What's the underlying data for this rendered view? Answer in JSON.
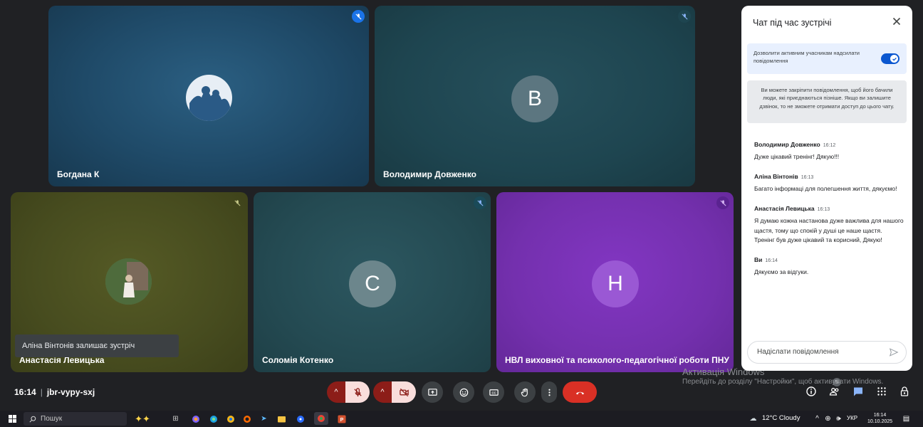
{
  "tiles": [
    {
      "name": "Богдана К",
      "initial": ""
    },
    {
      "name": "Володимир Довженко",
      "initial": "В"
    },
    {
      "name": "Анастасія Левицька",
      "initial": ""
    },
    {
      "name": "Соломія Котенко",
      "initial": "С"
    },
    {
      "name": "НВЛ виховної та психолого-педагогічної роботи ПНУ",
      "initial": "Н"
    }
  ],
  "toast": "Аліна Вінтонів залишає зустріч",
  "meeting": {
    "time": "16:14",
    "separator": "|",
    "code": "jbr-vypy-sxj"
  },
  "watermark": {
    "title": "Активація Windows",
    "subtitle": "Перейдіть до розділу \"Настройки\", щоб активувати Windows."
  },
  "controls": {
    "badge_count": "5"
  },
  "chat": {
    "title": "Чат під час зустрічі",
    "toggle_label": "Дозволити активним учасникам надсилати повідомлення",
    "toggle_on": true,
    "info": "Ви можете закріпити повідомлення, щоб його бачили люди, які приєднаються пізніше. Якщо ви залишите дзвінок, то не зможете отримати доступ до цього чату.",
    "messages": [
      {
        "author": "Володимир Довженко",
        "time": "16:12",
        "text": "Дуже цікавий тренінг! Дякую!!!"
      },
      {
        "author": "Аліна Вінтонів",
        "time": "16:13",
        "text": "Багато інформаці для полегшення життя, дякуємо!"
      },
      {
        "author": "Анастасія Левицька",
        "time": "16:13",
        "text": "Я думаю кожна настанова дуже важлива для нашого щастя, тому що спокій у душі це наше щастя. Тренінг був дуже цікавий та корисний, Дякую!"
      },
      {
        "author": "Ви",
        "time": "16:14",
        "text": "Дякуємо за відгуки."
      }
    ],
    "input_placeholder": "Надіслати повідомлення"
  },
  "taskbar": {
    "search": "Пошук",
    "weather": "12°C Cloudy",
    "lang": "УКР",
    "time": "16:14",
    "date": "10.10.2025"
  },
  "colors": {
    "tile_blue": "#1f4f6e",
    "tile_teal": "#1e4a55",
    "tile_olive": "#4a4f20",
    "tile_purple": "#7b2fb5",
    "end_call": "#d93025",
    "mic_off_bg": "#f9dedc",
    "chat_active": "#8ab4f8"
  }
}
